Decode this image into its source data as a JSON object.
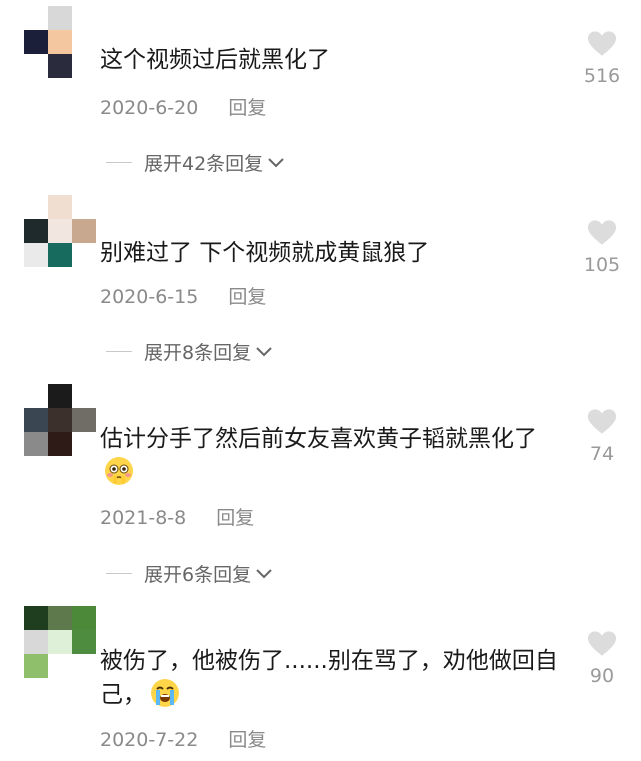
{
  "comments": [
    {
      "text": "这个视频过后就黑化了",
      "date": "2020-6-20",
      "reply": "回复",
      "likes": "516",
      "expand": "展开42条回复",
      "avatar_colors": [
        "#ffffff",
        "#d8d8d8",
        "#ffffff",
        "#1c1f3a",
        "#f5c7a0",
        "#ffffff",
        "#ffffff",
        "#2a2b3c",
        "#ffffff"
      ]
    },
    {
      "text": "别难过了 下个视频就成黄鼠狼了",
      "date": "2020-6-15",
      "reply": "回复",
      "likes": "105",
      "expand": "展开8条回复",
      "avatar_colors": [
        "#ffffff",
        "#f0dfd0",
        "#ffffff",
        "#1e2a2c",
        "#f1e7e0",
        "#c9a890",
        "#eaeaea",
        "#166b5e",
        "#ffffff"
      ]
    },
    {
      "text": "估计分手了然后前女友喜欢黄子韬就黑化了",
      "date": "2021-8-8",
      "reply": "回复",
      "likes": "74",
      "expand": "展开6条回复",
      "emoji": "flushed-face",
      "avatar_colors": [
        "#ffffff",
        "#1b1b1b",
        "#ffffff",
        "#3a4752",
        "#3c302c",
        "#6f6d66",
        "#8a8a8a",
        "#2e1a16",
        "#ffffff"
      ]
    },
    {
      "text": "被伤了，他被伤了......别在骂了，劝他做回自己，",
      "date": "2020-7-22",
      "reply": "回复",
      "likes": "90",
      "emoji": "crying-face",
      "avatar_colors": [
        "#1f3d1f",
        "#5e7a4d",
        "#4c8a3a",
        "#d8d8d8",
        "#dff0d8",
        "#4e8d3f",
        "#8fbf6a",
        "#ffffff",
        "#ffffff"
      ]
    }
  ],
  "colors": {
    "text": "#1a1a1a",
    "meta": "#8a8a8a",
    "heart": "#dcdcdc"
  }
}
